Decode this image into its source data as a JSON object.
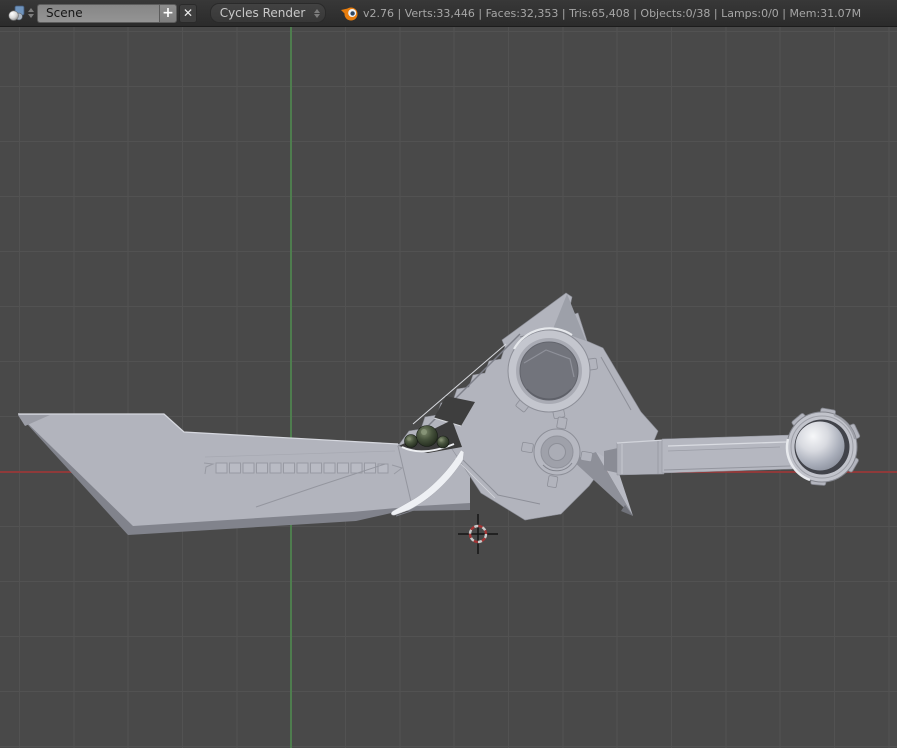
{
  "header": {
    "scene_field": {
      "value": "Scene"
    },
    "add_button": "+",
    "unlink_button": "✕",
    "engine_select": {
      "value": "Cycles Render"
    },
    "stats": "v2.76 | Verts:33,446 | Faces:32,353 | Tris:65,408 | Objects:0/38 | Lamps:0/0 | Mem:31.07M"
  },
  "viewport": {
    "model": "gray sci-fi greatsword 3D model",
    "colors": {
      "background": "#494949",
      "grid": "#525252",
      "axis_x_red": "#8f3a3a",
      "axis_y_green": "#4e7d4e",
      "model_face": "#b2b4bd",
      "model_shadow": "#81838c",
      "bolts_green": "#3c4634",
      "cursor_red": "#a33535"
    }
  }
}
